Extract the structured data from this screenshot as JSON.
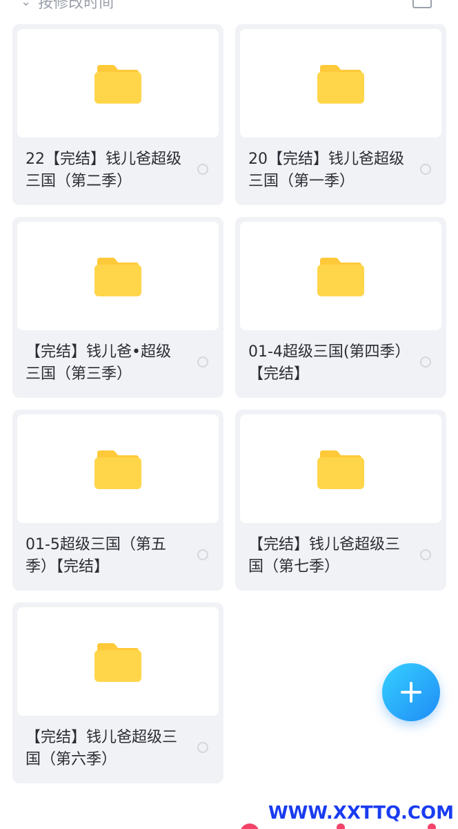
{
  "header": {
    "sort_label": "按修改时间"
  },
  "folders": [
    {
      "name": "22【完结】钱儿爸超级三国（第二季）"
    },
    {
      "name": "20【完结】钱儿爸超级三国（第一季）"
    },
    {
      "name": "【完结】钱儿爸•超级三国（第三季）"
    },
    {
      "name": "01-4超级三国(第四季）【完结】"
    },
    {
      "name": "01-5超级三国（第五季）【完结】"
    },
    {
      "name": "【完结】钱儿爸超级三国（第七季）"
    },
    {
      "name": "【完结】钱儿爸超级三国（第六季）"
    }
  ],
  "icons": {
    "folder": "folder-icon",
    "fab": "plus-icon",
    "view_toggle": "grid-view-icon"
  },
  "colors": {
    "folder": "#FFD54A",
    "folder_tab": "#FFC93A",
    "card_bg": "#F1F2F6",
    "fab_gradient_start": "#36D0FF",
    "fab_gradient_end": "#1F8CF6"
  },
  "watermark": "WWW.XXTTQ.COM"
}
